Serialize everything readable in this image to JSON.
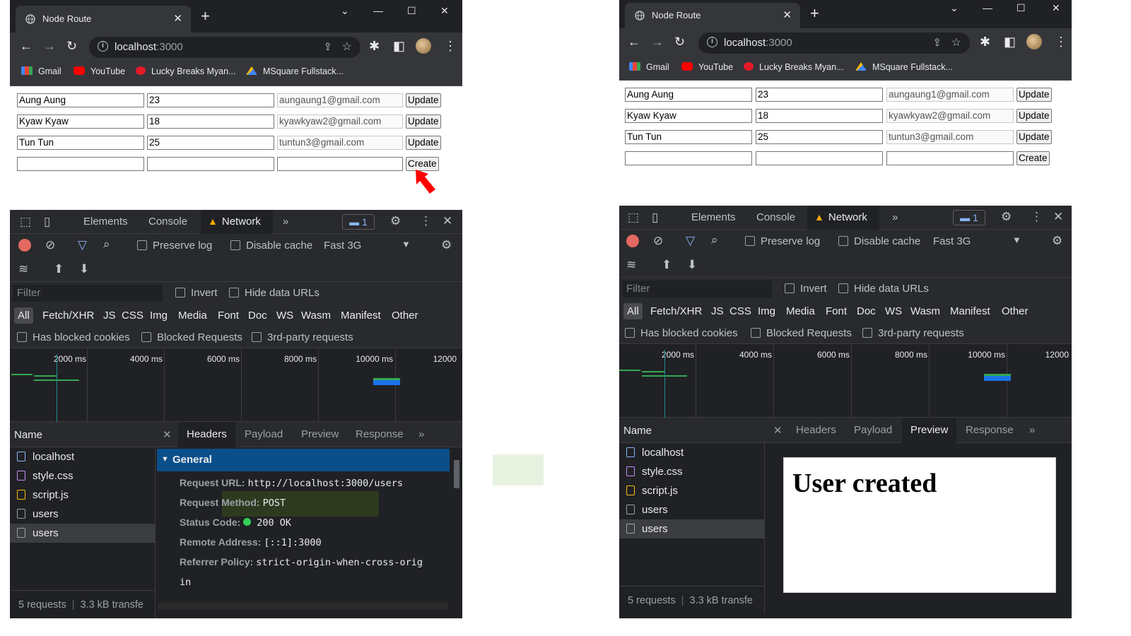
{
  "windows": [
    {
      "id": "left",
      "tab_title": "Node Route",
      "tab_close": "✕",
      "new_tab": "+",
      "url_host": "localhost",
      "url_port": ":3000",
      "bookmarks": [
        "Gmail",
        "YouTube",
        "Lucky Breaks Myan...",
        "MSquare Fullstack..."
      ],
      "users": [
        {
          "name": "Aung Aung",
          "age": "23",
          "email": "aungaung1@gmail.com",
          "button": "Update"
        },
        {
          "name": "Kyaw Kyaw",
          "age": "18",
          "email": "kyawkyaw2@gmail.com",
          "button": "Update"
        },
        {
          "name": "Tun Tun",
          "age": "25",
          "email": "tuntun3@gmail.com",
          "button": "Update"
        }
      ],
      "create_button": "Create",
      "devtools": {
        "tabs": [
          "Elements",
          "Console",
          "Network"
        ],
        "active_tab": "Network",
        "more": "»",
        "message_count": "1",
        "preserve_log": "Preserve log",
        "disable_cache": "Disable cache",
        "throttle": "Fast 3G",
        "filter_placeholder": "Filter",
        "invert": "Invert",
        "hide_data_urls": "Hide data URLs",
        "types": [
          "All",
          "Fetch/XHR",
          "JS",
          "CSS",
          "Img",
          "Media",
          "Font",
          "Doc",
          "WS",
          "Wasm",
          "Manifest",
          "Other"
        ],
        "has_blocked_cookies": "Has blocked cookies",
        "blocked_requests": "Blocked Requests",
        "third_party": "3rd-party requests",
        "timeline_labels": [
          "2000 ms",
          "4000 ms",
          "6000 ms",
          "8000 ms",
          "10000 ms",
          "12000"
        ],
        "name_header": "Name",
        "requests": [
          "localhost",
          "style.css",
          "script.js",
          "users",
          "users"
        ],
        "footer": "5 requests   3.3 kB transfe",
        "footer_requests": "5 requests",
        "footer_transfer": "3.3 kB transfe",
        "detail_tabs": [
          "Headers",
          "Payload",
          "Preview",
          "Response"
        ],
        "active_detail_tab": "Headers",
        "general_label": "General",
        "headers": [
          {
            "key": "Request URL:",
            "value": "http://localhost:3000/users"
          },
          {
            "key": "Request Method:",
            "value": "POST"
          },
          {
            "key": "Status Code:",
            "value": "200 OK"
          },
          {
            "key": "Remote Address:",
            "value": "[::1]:3000"
          },
          {
            "key": "Referrer Policy:",
            "value": "strict-origin-when-cross-orig"
          }
        ],
        "referrer_wrap": "in"
      }
    },
    {
      "id": "right",
      "tab_title": "Node Route",
      "url_host": "localhost",
      "url_port": ":3000",
      "bookmarks": [
        "Gmail",
        "YouTube",
        "Lucky Breaks Myan...",
        "MSquare Fullstack..."
      ],
      "users": [
        {
          "name": "Aung Aung",
          "age": "23",
          "email": "aungaung1@gmail.com",
          "button": "Update"
        },
        {
          "name": "Kyaw Kyaw",
          "age": "18",
          "email": "kyawkyaw2@gmail.com",
          "button": "Update"
        },
        {
          "name": "Tun Tun",
          "age": "25",
          "email": "tuntun3@gmail.com",
          "button": "Update"
        }
      ],
      "create_button": "Create",
      "active_detail_tab": "Preview",
      "preview_text": "User created"
    }
  ],
  "colors": {
    "accent": "#8ab4f8",
    "general_bar": "#0b4f8a",
    "status_ok": "#34d058",
    "warning": "#f9ab00",
    "arrow": "#ff0000"
  }
}
